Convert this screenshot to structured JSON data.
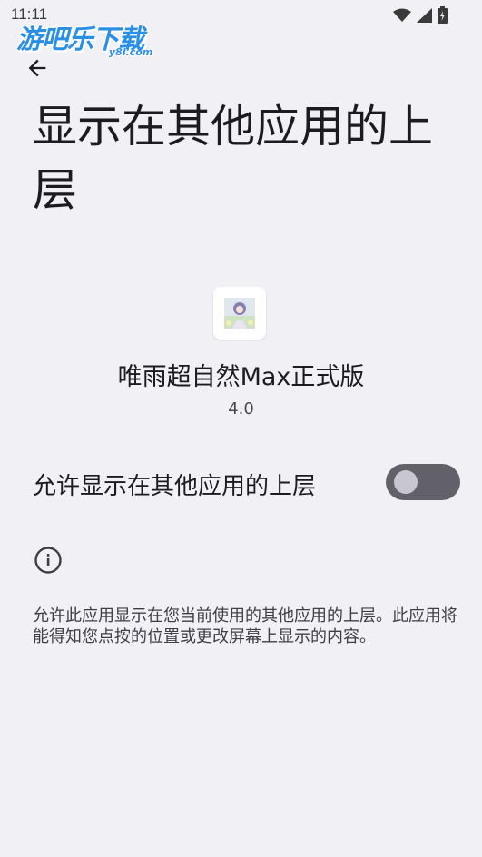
{
  "status_bar": {
    "time": "11:11",
    "icons": [
      "wifi-icon",
      "signal-icon",
      "battery-icon"
    ]
  },
  "watermark": {
    "main": "游吧乐下载",
    "sub": "y8l.com"
  },
  "header": {
    "back_icon": "arrow-left-icon",
    "title": "显示在其他应用的上层"
  },
  "app": {
    "name": "唯雨超自然Max正式版",
    "version": "4.0"
  },
  "permission": {
    "label": "允许显示在其他应用的上层",
    "enabled": false
  },
  "info": {
    "icon": "info-icon",
    "description": "允许此应用显示在您当前使用的其他应用的上层。此应用将能得知您点按的位置或更改屏幕上显示的内容。"
  },
  "colors": {
    "background": "#f1f0f4",
    "toggle_track_off": "#62616a",
    "toggle_knob_off": "#c8c7ce",
    "watermark": "#2b8fe6"
  }
}
